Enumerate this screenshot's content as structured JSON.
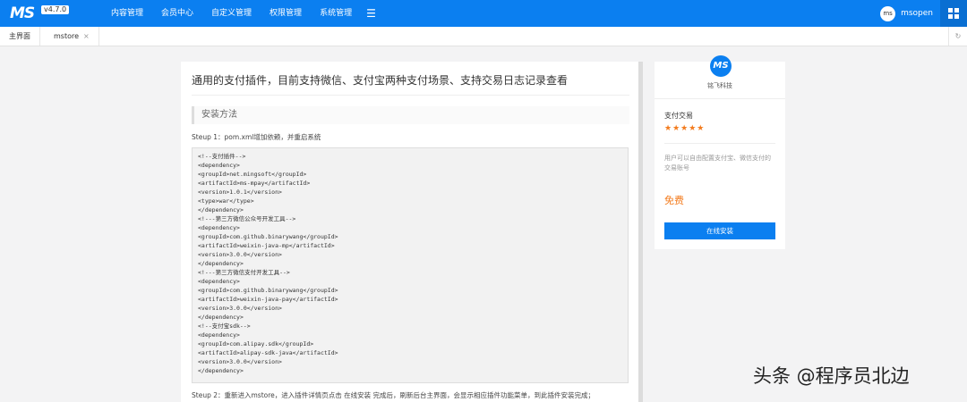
{
  "app": {
    "logo_text": "MS",
    "version": "v4.7.0"
  },
  "nav": {
    "items": [
      "内容管理",
      "会员中心",
      "自定义管理",
      "权限管理",
      "系统管理"
    ],
    "menu_icon": "menu-icon"
  },
  "user": {
    "avatar_text": "ms",
    "name": "msopen"
  },
  "tabs": {
    "home": "主界面",
    "mstore": "mstore",
    "close": "×",
    "refresh": "↻"
  },
  "main": {
    "title": "通用的支付插件，目前支持微信、支付宝两种支付场景、支持交易日志记录查看",
    "section_title": "安装方法",
    "step1": "Steup 1：pom.xml增加依赖，并重启系统",
    "code_lines": [
      "<!--支付插件-->",
      "<dependency>",
      "<groupId>net.mingsoft</groupId>",
      "<artifactId>ms-mpay</artifactId>",
      "<version>1.0.1</version>",
      "<type>war</type>",
      "</dependency>",
      "<!---第三方微信公众号开发工具-->",
      "<dependency>",
      "<groupId>com.github.binarywang</groupId>",
      "<artifactId>weixin-java-mp</artifactId>",
      "<version>3.0.0</version>",
      "</dependency>",
      "<!---第三方微信支付开发工具-->",
      "<dependency>",
      "<groupId>com.github.binarywang</groupId>",
      "<artifactId>weixin-java-pay</artifactId>",
      "<version>3.0.0</version>",
      "</dependency>",
      "<!--支付宝sdk-->",
      "<dependency>",
      "<groupId>com.alipay.sdk</groupId>",
      "<artifactId>alipay-sdk-java</artifactId>",
      "<version>3.0.0</version>",
      "</dependency>"
    ],
    "step2": "Steup 2：重新进入mstore，进入插件详情页点击 在线安装 完成后，刷新后台主界面，会显示相应插件功能菜单，到此插件安装完成；"
  },
  "side": {
    "logo_text": "MS",
    "company": "铭飞科技",
    "plugin_name": "支付交易",
    "stars": "★★★★★",
    "rating": 5,
    "description": "用户可以自由配置支付宝、微信支付的交易账号",
    "price": "免费",
    "install_label": "在线安装"
  },
  "watermark": "头条 @程序员北边",
  "colors": {
    "primary": "#0b7ff0",
    "accent": "#f37b1d"
  }
}
